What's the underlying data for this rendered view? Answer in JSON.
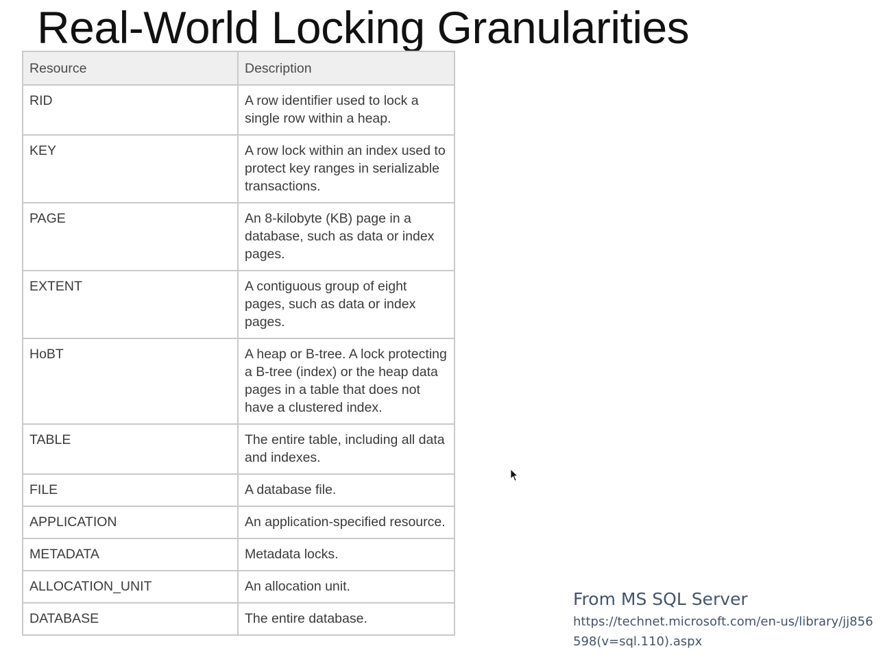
{
  "slide": {
    "title": "Real-World Locking Granularities"
  },
  "table": {
    "headers": [
      "Resource",
      "Description"
    ],
    "rows": [
      {
        "resource": "RID",
        "description": "A row identifier used to lock a single row within a heap."
      },
      {
        "resource": "KEY",
        "description": "A row lock within an index used to protect key ranges in serializable transactions."
      },
      {
        "resource": "PAGE",
        "description": "An 8-kilobyte (KB) page in a database, such as data or index pages."
      },
      {
        "resource": "EXTENT",
        "description": "A contiguous group of eight pages, such as data or index pages."
      },
      {
        "resource": "HoBT",
        "description": "A heap or B-tree. A lock protecting a B-tree (index) or the heap data pages in a table that does not have a clustered index."
      },
      {
        "resource": "TABLE",
        "description": "The entire table, including all data and indexes."
      },
      {
        "resource": "FILE",
        "description": "A database file."
      },
      {
        "resource": "APPLICATION",
        "description": "An application-specified resource."
      },
      {
        "resource": "METADATA",
        "description": "Metadata locks."
      },
      {
        "resource": "ALLOCATION_UNIT",
        "description": "An allocation unit."
      },
      {
        "resource": "DATABASE",
        "description": "The entire database."
      }
    ]
  },
  "source": {
    "title": "From MS SQL Server",
    "link": "https://technet.microsoft.com/en-us/library/jj856598(v=sql.110).aspx"
  },
  "icons": {
    "cursor": "mouse-pointer-icon"
  }
}
